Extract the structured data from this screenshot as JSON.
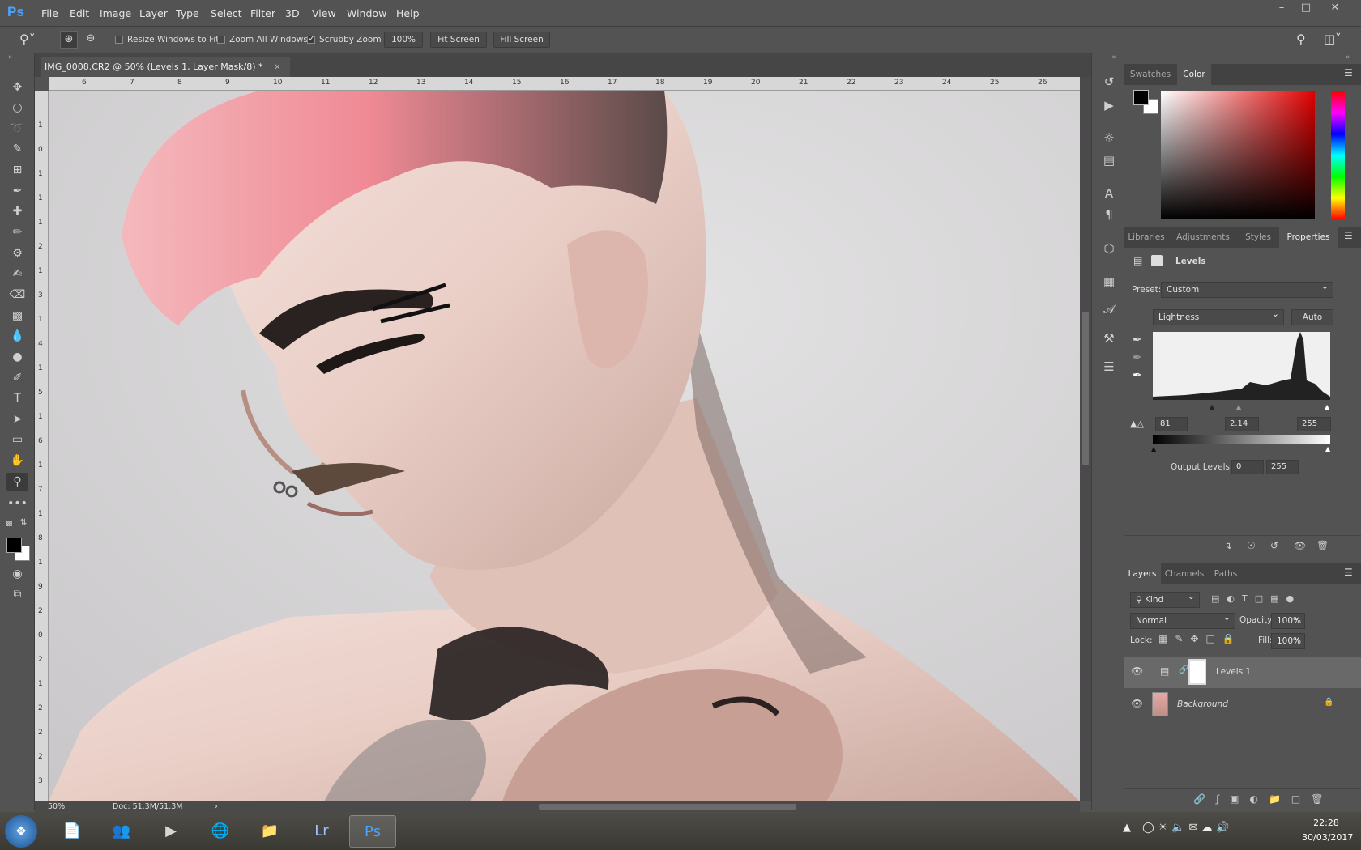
{
  "app": {
    "logo": "Ps"
  },
  "menu": [
    "File",
    "Edit",
    "Image",
    "Layer",
    "Type",
    "Select",
    "Filter",
    "3D",
    "View",
    "Window",
    "Help"
  ],
  "options": {
    "resize_windows": "Resize Windows to Fit",
    "zoom_all": "Zoom All Windows",
    "scrubby": "Scrubby Zoom",
    "zoom_value": "100%",
    "fit_screen": "Fit Screen",
    "fill_screen": "Fill Screen"
  },
  "document": {
    "tab_title": "IMG_0008.CR2 @ 50% (Levels 1, Layer Mask/8) *",
    "zoom": "50%",
    "doc_size": "Doc: 51.3M/51.3M"
  },
  "ruler": {
    "h": [
      "6",
      "7",
      "8",
      "9",
      "10",
      "11",
      "12",
      "13",
      "14",
      "15",
      "16",
      "17",
      "18",
      "19",
      "20",
      "21",
      "22",
      "23",
      "24",
      "25",
      "26"
    ],
    "v": [
      "1",
      "0",
      "1",
      "1",
      "1",
      "2",
      "1",
      "3",
      "1",
      "4",
      "1",
      "5",
      "1",
      "6",
      "1",
      "7",
      "1",
      "8",
      "1",
      "9",
      "2",
      "0",
      "2",
      "1",
      "2",
      "2",
      "2",
      "3"
    ]
  },
  "color_panel": {
    "tabs": [
      "Swatches",
      "Color"
    ],
    "active": "Color",
    "fg": "#000000",
    "bg": "#ffffff"
  },
  "props_panel": {
    "tabs": [
      "Libraries",
      "Adjustments",
      "Styles",
      "Properties"
    ],
    "active": "Properties",
    "title": "Levels",
    "preset_label": "Preset:",
    "preset_value": "Custom",
    "channel": "Lightness",
    "auto": "Auto",
    "input_black": "81",
    "input_gamma": "2.14",
    "input_white": "255",
    "output_label": "Output Levels:",
    "output_black": "0",
    "output_white": "255"
  },
  "layers_panel": {
    "tabs": [
      "Layers",
      "Channels",
      "Paths"
    ],
    "active": "Layers",
    "kind": "Kind",
    "blend": "Normal",
    "opacity_label": "Opacity:",
    "opacity": "100%",
    "lock_label": "Lock:",
    "fill_label": "Fill:",
    "fill": "100%",
    "layers": [
      {
        "name": "Levels 1",
        "selected": true
      },
      {
        "name": "Background",
        "selected": false
      }
    ]
  },
  "taskbar": {
    "lr": "Lr",
    "ps": "Ps",
    "time": "22:28",
    "date": "30/03/2017"
  }
}
